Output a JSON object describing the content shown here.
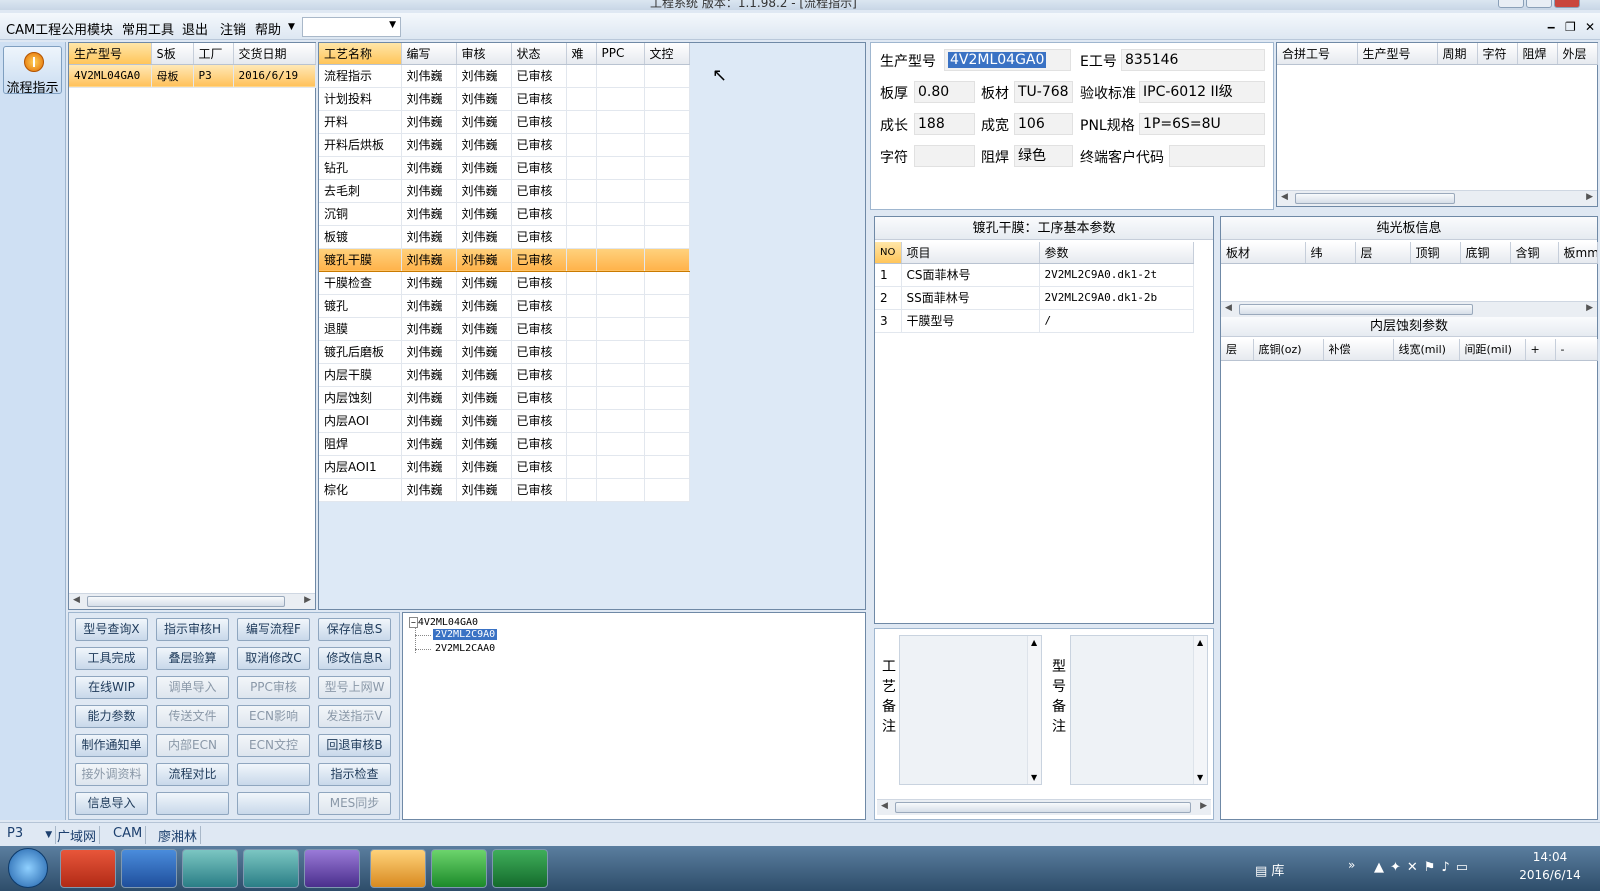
{
  "window": {
    "title": "工程系统  版本：1.1.98.2 - [流程指示]"
  },
  "menu": {
    "items": [
      "CAM工程",
      "公用模块",
      "常用工具",
      "退出",
      "注销",
      "帮助"
    ],
    "combo": ""
  },
  "sidebar": {
    "button": "流程指示"
  },
  "list": {
    "columns": [
      "生产型号",
      "S板",
      "工厂",
      "交货日期"
    ],
    "rows": [
      [
        "4V2ML04GA0",
        "母板",
        "P3",
        "2016/6/19"
      ]
    ]
  },
  "process": {
    "columns": [
      "工艺名称",
      "编写",
      "审核",
      "状态",
      "难",
      "PPC",
      "文控"
    ],
    "rows": [
      [
        "流程指示",
        "刘伟巍",
        "刘伟巍",
        "已审核"
      ],
      [
        "计划投料",
        "刘伟巍",
        "刘伟巍",
        "已审核"
      ],
      [
        "开料",
        "刘伟巍",
        "刘伟巍",
        "已审核"
      ],
      [
        "开料后烘板",
        "刘伟巍",
        "刘伟巍",
        "已审核"
      ],
      [
        "钻孔",
        "刘伟巍",
        "刘伟巍",
        "已审核"
      ],
      [
        "去毛刺",
        "刘伟巍",
        "刘伟巍",
        "已审核"
      ],
      [
        "沉铜",
        "刘伟巍",
        "刘伟巍",
        "已审核"
      ],
      [
        "板镀",
        "刘伟巍",
        "刘伟巍",
        "已审核"
      ],
      [
        "镀孔干膜",
        "刘伟巍",
        "刘伟巍",
        "已审核"
      ],
      [
        "干膜检查",
        "刘伟巍",
        "刘伟巍",
        "已审核"
      ],
      [
        "镀孔",
        "刘伟巍",
        "刘伟巍",
        "已审核"
      ],
      [
        "退膜",
        "刘伟巍",
        "刘伟巍",
        "已审核"
      ],
      [
        "镀孔后磨板",
        "刘伟巍",
        "刘伟巍",
        "已审核"
      ],
      [
        "内层干膜",
        "刘伟巍",
        "刘伟巍",
        "已审核"
      ],
      [
        "内层蚀刻",
        "刘伟巍",
        "刘伟巍",
        "已审核"
      ],
      [
        "内层AOI",
        "刘伟巍",
        "刘伟巍",
        "已审核"
      ],
      [
        "阻焊",
        "刘伟巍",
        "刘伟巍",
        "已审核"
      ],
      [
        "内层AOI1",
        "刘伟巍",
        "刘伟巍",
        "已审核"
      ],
      [
        "棕化",
        "刘伟巍",
        "刘伟巍",
        "已审核"
      ]
    ],
    "selected": "镀孔干膜"
  },
  "buttons": [
    "型号查询X",
    "指示审核H",
    "编写流程F",
    "保存信息S",
    "工具完成",
    "叠层验算",
    "取消修改C",
    "修改信息R",
    "在线WIP",
    "调单导入",
    "PPC审核",
    "型号上网W",
    "能力参数",
    "传送文件",
    "ECN影响",
    "发送指示V",
    "制作通知单",
    "内部ECN",
    "ECN文控",
    "回退审核B",
    "接外调资料",
    "流程对比",
    "",
    "指示检查",
    "信息导入",
    "",
    "",
    "MES同步"
  ],
  "disabled_buttons": [
    "调单导入",
    "PPC审核",
    "型号上网W",
    "传送文件",
    "ECN影响",
    "发送指示V",
    "内部ECN",
    "ECN文控",
    "接外调资料",
    "MES同步"
  ],
  "tree": {
    "root": "4V2ML04GA0",
    "children": [
      "2V2ML2C9A0",
      "2V2ML2CAA0"
    ],
    "selected": "2V2ML2C9A0"
  },
  "info": {
    "labels": {
      "model": "生产型号",
      "eno": "E工号",
      "thickness": "板厚",
      "material": "板材",
      "standard": "验收标准",
      "length": "成长",
      "width": "成宽",
      "pnl": "PNL规格",
      "char": "字符",
      "mask": "阻焊",
      "customer": "终端客户代码"
    },
    "values": {
      "model": "4V2ML04GA0",
      "eno": "835146",
      "thickness": "0.80",
      "material": "TU-768",
      "standard": "IPC-6012 II级",
      "length": "188",
      "width": "106",
      "pnl": "1P=6S=8U",
      "char": "",
      "mask": "绿色",
      "customer": ""
    }
  },
  "combine": {
    "columns": [
      "合拼工号",
      "生产型号",
      "周期",
      "字符",
      "阻焊",
      "外层"
    ]
  },
  "params": {
    "title": "镀孔干膜：工序基本参数",
    "columns": [
      "NO",
      "项目",
      "参数"
    ],
    "rows": [
      [
        "1",
        "CS面菲林号",
        "2V2ML2C9A0.dk1-2t"
      ],
      [
        "2",
        "SS面菲林号",
        "2V2ML2C9A0.dk1-2b"
      ],
      [
        "3",
        "干膜型号",
        "/"
      ]
    ]
  },
  "core": {
    "title": "纯光板信息",
    "columns": [
      "板材",
      "纬",
      "层",
      "顶铜",
      "底铜",
      "含铜",
      "板mm"
    ]
  },
  "etch": {
    "title": "内层蚀刻参数",
    "columns": [
      "层",
      "底铜(oz)",
      "补偿",
      "线宽(mil)",
      "间距(mil)",
      "+",
      "-"
    ]
  },
  "notes": {
    "process_label": "工艺备注",
    "model_label": "型号备注"
  },
  "status": {
    "factory": "P3",
    "items": [
      "广域网",
      "CAM",
      "廖湘林"
    ]
  },
  "taskbar": {
    "apps": [
      "foxit-reader",
      "save",
      "network-fish",
      "network-fish-2",
      "x-tool",
      "shell-tool",
      "pgp-tool",
      "excel"
    ],
    "tray": {
      "folder": "库",
      "time": "14:04",
      "date": "2016/6/14"
    }
  }
}
